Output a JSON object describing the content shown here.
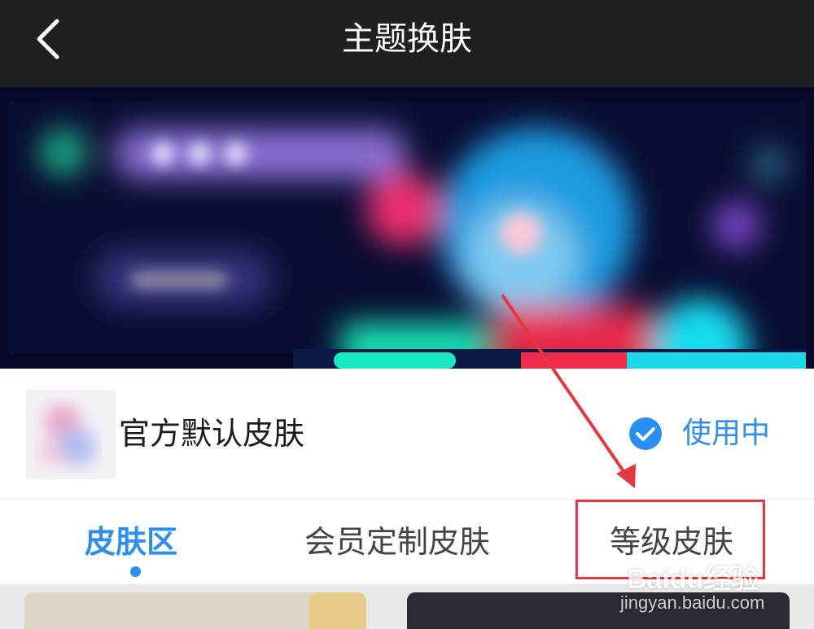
{
  "header": {
    "title": "主题换肤",
    "back_icon": "chevron-left-icon"
  },
  "current_skin": {
    "name": "官方默认皮肤",
    "status": "使用中",
    "status_icon": "check-circle-icon"
  },
  "tabs": [
    {
      "label": "皮肤区",
      "active": true
    },
    {
      "label": "会员定制皮肤",
      "active": false
    },
    {
      "label": "等级皮肤",
      "active": false
    }
  ],
  "watermark": {
    "logo": "Baidu经验",
    "url": "jingyan.baidu.com"
  },
  "colors": {
    "header_bg": "#1f2023",
    "accent": "#2a8ff0",
    "annotation": "#e7363f",
    "banner_bg": "#07082a"
  }
}
